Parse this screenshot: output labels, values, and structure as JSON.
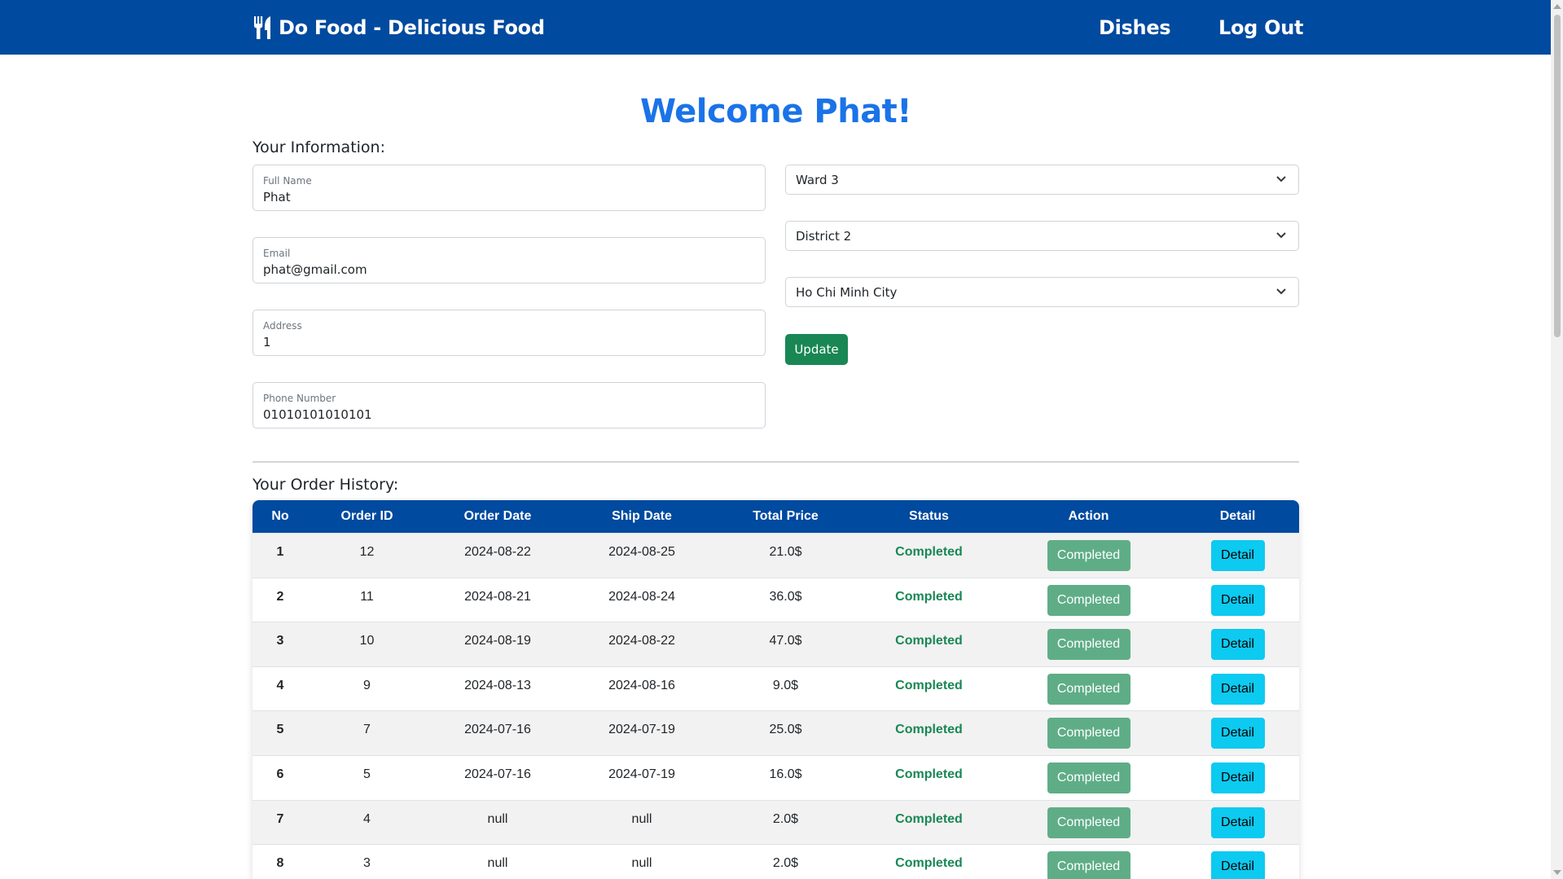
{
  "navbar": {
    "brand": "Do Food - Delicious Food",
    "brand_icon": "utensils-icon",
    "links": [
      {
        "label": "Dishes"
      },
      {
        "label": "Log Out"
      }
    ],
    "background": "#004a9f"
  },
  "welcome": "Welcome Phat!",
  "info": {
    "title": "Your Information:",
    "fields": [
      {
        "label": "Full Name",
        "value": "Phat"
      },
      {
        "label": "Email",
        "value": "phat@gmail.com"
      },
      {
        "label": "Address",
        "value": "1"
      },
      {
        "label": "Phone Number",
        "value": "01010101010101"
      }
    ],
    "selects": [
      {
        "value": "Ward 3"
      },
      {
        "value": "District 2"
      },
      {
        "value": "Ho Chi Minh City"
      }
    ],
    "update_label": "Update"
  },
  "history": {
    "title": "Your Order History:",
    "headers": [
      "No",
      "Order ID",
      "Order Date",
      "Ship Date",
      "Total Price",
      "Status",
      "Action",
      "Detail"
    ],
    "rows": [
      {
        "no": "1",
        "order_id": "12",
        "order_date": "2024-08-22",
        "ship_date": "2024-08-25",
        "total": "21.0$",
        "status": "Completed",
        "action": "Completed",
        "detail": "Detail"
      },
      {
        "no": "2",
        "order_id": "11",
        "order_date": "2024-08-21",
        "ship_date": "2024-08-24",
        "total": "36.0$",
        "status": "Completed",
        "action": "Completed",
        "detail": "Detail"
      },
      {
        "no": "3",
        "order_id": "10",
        "order_date": "2024-08-19",
        "ship_date": "2024-08-22",
        "total": "47.0$",
        "status": "Completed",
        "action": "Completed",
        "detail": "Detail"
      },
      {
        "no": "4",
        "order_id": "9",
        "order_date": "2024-08-13",
        "ship_date": "2024-08-16",
        "total": "9.0$",
        "status": "Completed",
        "action": "Completed",
        "detail": "Detail"
      },
      {
        "no": "5",
        "order_id": "7",
        "order_date": "2024-07-16",
        "ship_date": "2024-07-19",
        "total": "25.0$",
        "status": "Completed",
        "action": "Completed",
        "detail": "Detail"
      },
      {
        "no": "6",
        "order_id": "5",
        "order_date": "2024-07-16",
        "ship_date": "2024-07-19",
        "total": "16.0$",
        "status": "Completed",
        "action": "Completed",
        "detail": "Detail"
      },
      {
        "no": "7",
        "order_id": "4",
        "order_date": "null",
        "ship_date": "null",
        "total": "2.0$",
        "status": "Completed",
        "action": "Completed",
        "detail": "Detail"
      },
      {
        "no": "8",
        "order_id": "3",
        "order_date": "null",
        "ship_date": "null",
        "total": "2.0$",
        "status": "Completed",
        "action": "Completed",
        "detail": "Detail"
      }
    ]
  },
  "colors": {
    "accent": "#1a73e8",
    "success": "#198754",
    "completed_button": "#5fad87",
    "detail_button": "#0dcaf0"
  }
}
